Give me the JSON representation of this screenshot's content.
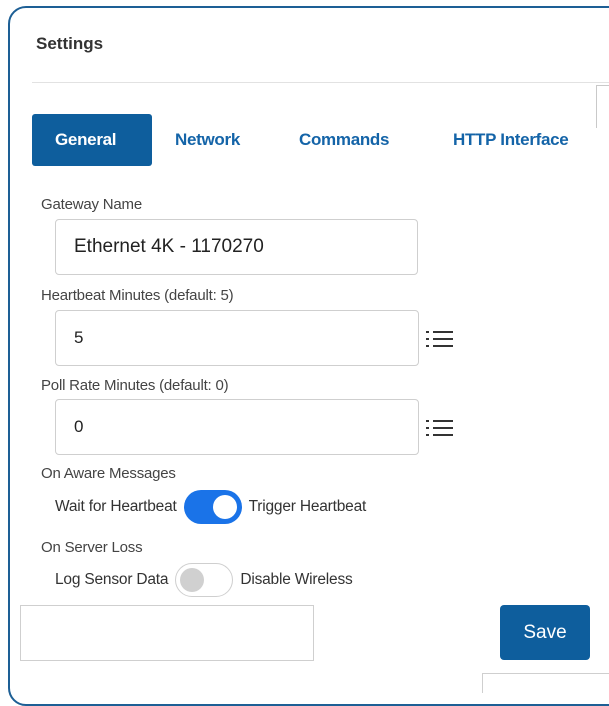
{
  "panel": {
    "title": "Settings"
  },
  "tabs": [
    {
      "label": "General",
      "active": true
    },
    {
      "label": "Network",
      "active": false
    },
    {
      "label": "Commands",
      "active": false
    },
    {
      "label": "HTTP Interface",
      "active": false
    }
  ],
  "general": {
    "gateway_name": {
      "label": "Gateway Name",
      "value": "Ethernet 4K - 1170270"
    },
    "heartbeat_minutes": {
      "label": "Heartbeat Minutes (default: 5)",
      "value": "5",
      "icon": "list-icon"
    },
    "poll_rate_minutes": {
      "label": "Poll Rate Minutes (default: 0)",
      "value": "0",
      "icon": "list-icon"
    },
    "on_aware_messages": {
      "label": "On Aware Messages",
      "left_option": "Wait for Heartbeat",
      "right_option": "Trigger Heartbeat",
      "enabled": true
    },
    "on_server_loss": {
      "label": "On Server Loss",
      "left_option": "Log Sensor Data",
      "right_option": "Disable Wireless",
      "enabled": false
    }
  },
  "footer": {
    "input_value": "",
    "save_label": "Save"
  },
  "colors": {
    "primary": "#0e5e9d",
    "tab_link": "#1464a8",
    "toggle_on": "#1a73e8",
    "frame_border": "#1d5f95"
  }
}
